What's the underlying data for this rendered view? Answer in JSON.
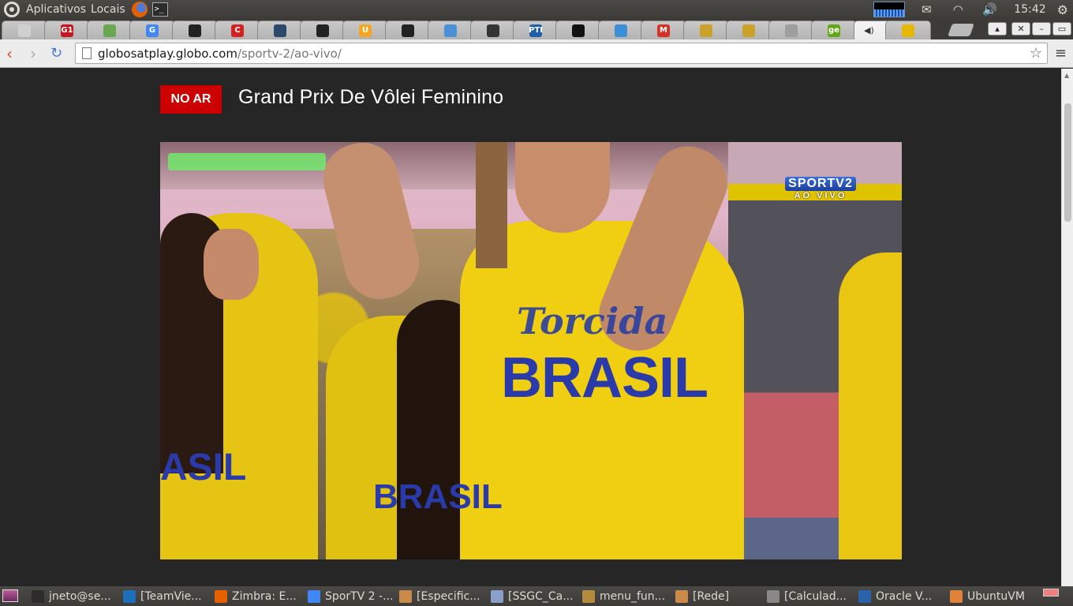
{
  "top_panel": {
    "apps_label": "Aplicativos",
    "places_label": "Locais",
    "clock": "15:42"
  },
  "tabs": {
    "favicons": [
      {
        "label": "",
        "color": "#d0d0d0"
      },
      {
        "label": "G1",
        "color": "#c4161c"
      },
      {
        "label": "",
        "color": "#6aa84f"
      },
      {
        "label": "G",
        "color": "#4285f4"
      },
      {
        "label": "",
        "color": "#222222"
      },
      {
        "label": "C",
        "color": "#d32020"
      },
      {
        "label": "",
        "color": "#2b4a6b"
      },
      {
        "label": "",
        "color": "#222222"
      },
      {
        "label": "U",
        "color": "#f5a623"
      },
      {
        "label": "",
        "color": "#222222"
      },
      {
        "label": "",
        "color": "#4a90d9"
      },
      {
        "label": "",
        "color": "#333333"
      },
      {
        "label": "PTI",
        "color": "#1f5fa8"
      },
      {
        "label": "",
        "color": "#111111"
      },
      {
        "label": "",
        "color": "#3b8fd6"
      },
      {
        "label": "M",
        "color": "#d93025"
      },
      {
        "label": "",
        "color": "#c9a227"
      },
      {
        "label": "",
        "color": "#c9a227"
      },
      {
        "label": "",
        "color": "#9e9e9e"
      },
      {
        "label": "ge",
        "color": "#63a814"
      },
      {
        "label": "",
        "color": "#e6b800"
      }
    ]
  },
  "omnibox": {
    "url_host": "globosatplay.globo.com",
    "url_path": "/sportv-2/ao-vivo/"
  },
  "page": {
    "live_badge": "NO AR",
    "title": "Grand Prix De Vôlei Feminino"
  },
  "video": {
    "channel_logo": "SPORTV2",
    "channel_sub": "AO VIVO",
    "shirt_text_main_1": "Torcida",
    "shirt_text_main_2": "BRASIL",
    "shirt_text_left": "ASIL",
    "shirt_text_mid": "BRASIL"
  },
  "taskbar": {
    "items": [
      {
        "label": "jneto@se...",
        "icon": "terminal-icon",
        "color": "#2c2c2c"
      },
      {
        "label": "[TeamVie...",
        "icon": "teamviewer-icon",
        "color": "#1c6fb8"
      },
      {
        "label": "Zimbra: E...",
        "icon": "firefox-icon",
        "color": "#e66000"
      },
      {
        "label": "SporTV 2 -...",
        "icon": "chrome-icon",
        "color": "#4285f4"
      },
      {
        "label": "[Especific...",
        "icon": "folder-icon",
        "color": "#c98a4b"
      },
      {
        "label": "[SSGC_Ca...",
        "icon": "document-icon",
        "color": "#8aa0c8"
      },
      {
        "label": "menu_fun...",
        "icon": "gimp-icon",
        "color": "#b38b3d"
      },
      {
        "label": "[Rede]",
        "icon": "folder-icon",
        "color": "#c98a4b"
      },
      {
        "label": "[Calculad...",
        "icon": "calculator-icon",
        "color": "#888888"
      },
      {
        "label": "Oracle V...",
        "icon": "virtualbox-icon",
        "color": "#2a63a9"
      },
      {
        "label": "UbuntuVM",
        "icon": "folder-icon",
        "color": "#e0833a"
      }
    ]
  }
}
